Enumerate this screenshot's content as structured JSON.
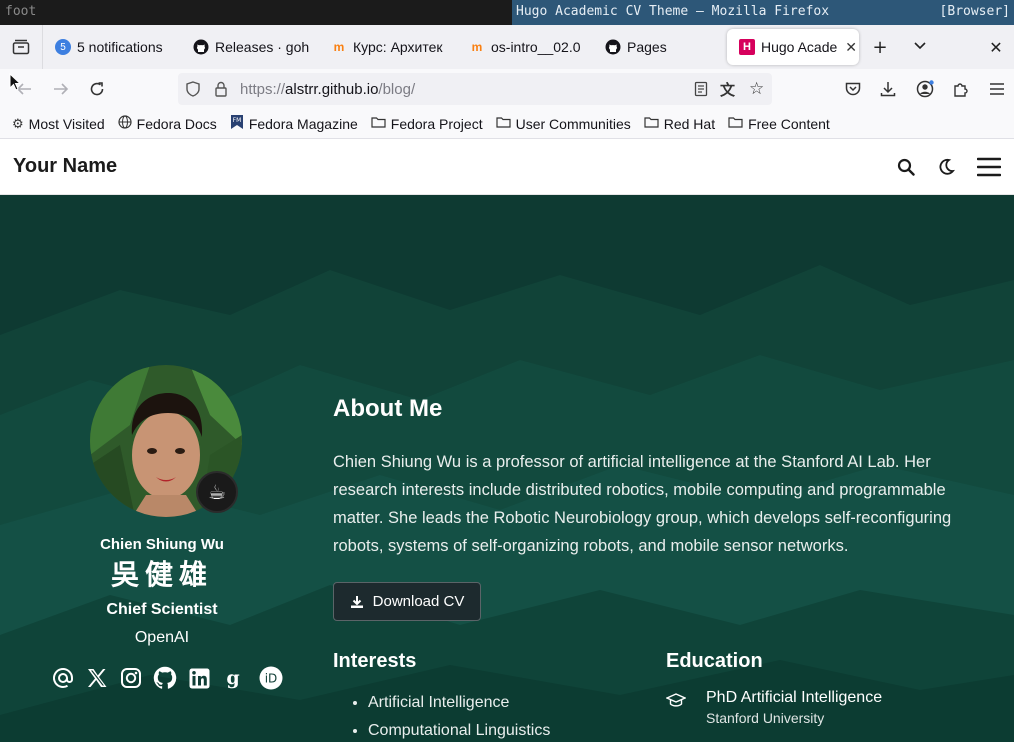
{
  "desktop": {
    "left_title": "foot",
    "window_title": "Hugo Academic CV Theme — Mozilla Firefox",
    "workspace_tag": "[Browser]"
  },
  "tabs": [
    {
      "label": "5 notifications",
      "badge": "5"
    },
    {
      "label": "Releases · goh"
    },
    {
      "label": "Курс: Архитек"
    },
    {
      "label": "os-intro__02.0"
    },
    {
      "label": "Pages"
    },
    {
      "label": "Hugo Acade",
      "active": true
    }
  ],
  "url": {
    "scheme": "https://",
    "host": "alstrr.github.io",
    "path": "/blog/"
  },
  "bookmarks": [
    {
      "label": "Most Visited",
      "icon": "gear-icon"
    },
    {
      "label": "Fedora Docs",
      "icon": "globe-icon"
    },
    {
      "label": "Fedora Magazine",
      "icon": "fm-icon"
    },
    {
      "label": "Fedora Project",
      "icon": "folder-icon"
    },
    {
      "label": "User Communities",
      "icon": "folder-icon"
    },
    {
      "label": "Red Hat",
      "icon": "folder-icon"
    },
    {
      "label": "Free Content",
      "icon": "folder-icon"
    }
  ],
  "site": {
    "brand": "Your Name"
  },
  "profile": {
    "name": "Chien Shiung Wu",
    "name_cjk": "吳健雄",
    "role": "Chief Scientist",
    "org": "OpenAI",
    "status_emoji": "☕"
  },
  "about": {
    "title": "About Me",
    "bio": "Chien Shiung Wu is a professor of artificial intelligence at the Stanford AI Lab. Her research interests include distributed robotics, mobile computing and programmable matter. She leads the Robotic Neurobiology group, which develops self-reconfiguring robots, systems of self-organizing robots, and mobile sensor networks.",
    "cv_label": "Download CV"
  },
  "interests": {
    "title": "Interests",
    "items": [
      "Artificial Intelligence",
      "Computational Linguistics"
    ]
  },
  "education": {
    "title": "Education",
    "items": [
      {
        "degree": "PhD Artificial Intelligence",
        "school": "Stanford University"
      }
    ]
  },
  "colors": {
    "hero_bg": "#0f3d35",
    "accent_tab": "#d6005c",
    "topbar_active": "#2d5778"
  }
}
